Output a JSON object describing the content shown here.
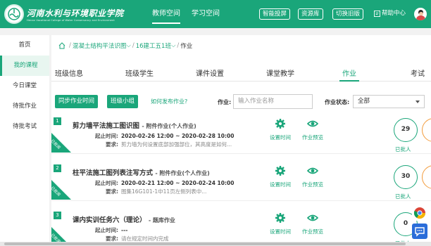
{
  "header": {
    "school_name": "河南水利与环境职业学院",
    "school_name_en": "Henan Vocational College of Water Conservancy and Environment",
    "nav": [
      {
        "label": "教师空间",
        "active": true
      },
      {
        "label": "学习空间",
        "active": false
      }
    ],
    "buttons": [
      "智能投屏",
      "资源库",
      "切换旧版"
    ],
    "help": "帮助中心",
    "accent": "#1aa67a"
  },
  "sidebar": {
    "items": [
      {
        "label": "首页",
        "active": false
      },
      {
        "label": "我的课程",
        "active": true
      },
      {
        "label": "今日课堂",
        "active": false
      },
      {
        "label": "待批作业",
        "active": false
      },
      {
        "label": "待批考试",
        "active": false
      }
    ]
  },
  "breadcrumb": {
    "course": "混凝土结构平法识图",
    "class": "16建工五1班",
    "current": "作业"
  },
  "tabs": [
    "班级信息",
    "班级学生",
    "课件设置",
    "课堂教学",
    "作业",
    "考试"
  ],
  "toolbar": {
    "sync_btn": "同步作业时间",
    "group_btn": "班级小组",
    "how_link": "如何发布作业?",
    "hw_label": "作业:",
    "hw_placeholder": "输入作业名称",
    "status_label": "作业状态:",
    "status_value": "全部"
  },
  "assignments": [
    {
      "index": "1",
      "ribbon": "已批阅",
      "title": "剪力墙平法施工图识图",
      "type": "- 附件作业(个人作业)",
      "start_key": "起止时间:",
      "time": "2020-02-26 12:00 ~ 2020-02-28 10:00",
      "req_key": "要求:",
      "requirement": "剪力墙为何设置底部加强部位，其高度是如何...",
      "action1": "设置时间",
      "action2": "作业预览",
      "count": "29",
      "count_label": "已批人"
    },
    {
      "index": "2",
      "ribbon": "已批阅",
      "title": "柱平法施工图列表注写方式",
      "type": "- 附件作业(个人作业)",
      "start_key": "起止时间:",
      "time": "2020-02-21 12:00 ~ 2020-02-24 10:00",
      "req_key": "要求:",
      "requirement": "图集16G101-1中11页左侧列表中...",
      "action1": "设置时间",
      "action2": "作业预览",
      "count": "30",
      "count_label": "已批人"
    },
    {
      "index": "3",
      "ribbon": "已批阅",
      "title": "课内实训任务六（理论）",
      "type": "- 题库作业",
      "start_key": "起止时间:",
      "time": "---",
      "req_key": "要求:",
      "requirement": "请在规定时间内完成",
      "action1": "设置时间",
      "action2": "作业预览",
      "count": "0",
      "count_label": "已批人"
    }
  ]
}
